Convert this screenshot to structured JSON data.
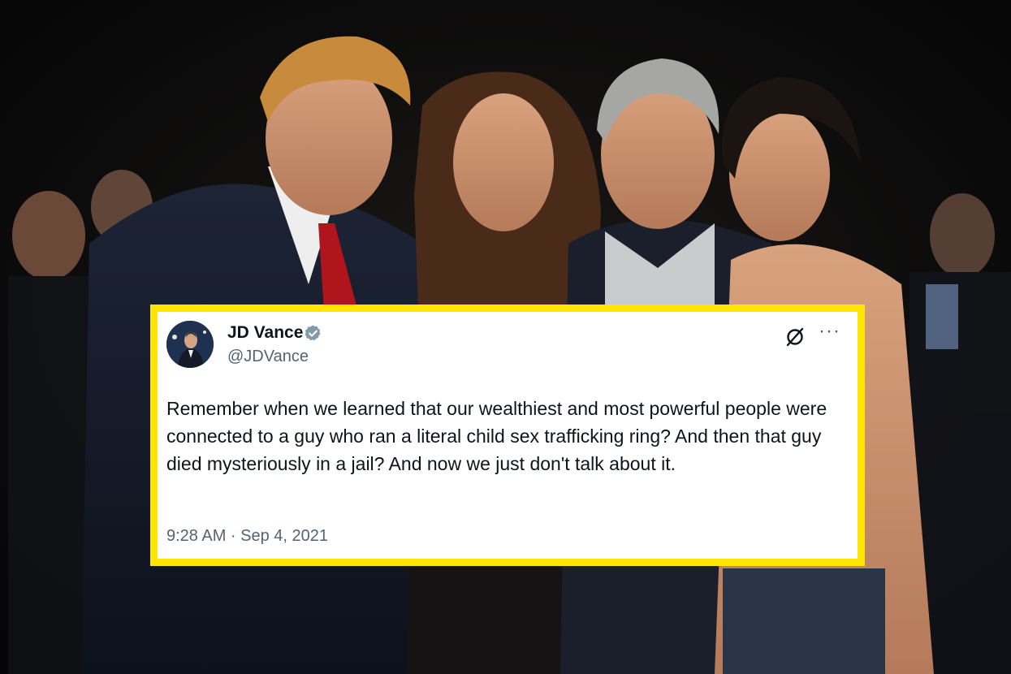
{
  "tweet": {
    "author_name": "JD Vance",
    "author_handle": "@JDVance",
    "verified_icon": "verified-badge-icon",
    "grok_icon": "grok-icon",
    "more_icon": "more-options-icon",
    "more_label": "···",
    "text": "Remember when we learned that our wealthiest and most powerful people were connected to a guy who ran a literal child sex trafficking ring? And then that guy died mysteriously in a jail? And now we just don't talk about it.",
    "timestamp": "9:28 AM · Sep 4, 2021"
  },
  "colors": {
    "frame_yellow": "#ffe500",
    "tweet_text": "#0f1419",
    "secondary_text": "#536471",
    "verified_blue": "#1d9bf0"
  }
}
